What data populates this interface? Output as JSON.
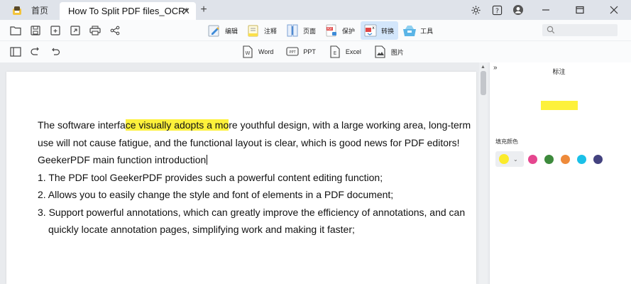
{
  "titlebar": {
    "home_tab": "首页",
    "doc_tab": "How To Split PDF files_OCR*",
    "close": "✕",
    "new_tab": "+"
  },
  "toolbar_modes": [
    {
      "label": "编辑",
      "icon": "edit-icon"
    },
    {
      "label": "注释",
      "icon": "annotate-icon"
    },
    {
      "label": "页面",
      "icon": "page-icon"
    },
    {
      "label": "保护",
      "icon": "protect-icon"
    },
    {
      "label": "转换",
      "icon": "convert-icon",
      "active": true
    },
    {
      "label": "工具",
      "icon": "tools-icon"
    }
  ],
  "convert_options": [
    {
      "label": "Word",
      "icon": "word-icon"
    },
    {
      "label": "PPT",
      "icon": "ppt-icon"
    },
    {
      "label": "Excel",
      "icon": "excel-icon"
    },
    {
      "label": "图片",
      "icon": "image-icon"
    }
  ],
  "document": {
    "line1_a": "The software interfa",
    "line1_hl": "ce visually adopts a mo",
    "line1_b": "re youthful design, with a large working area, long-term",
    "line2": "use will not cause fatigue, and the functional layout is clear, which is good news for PDF editors!",
    "line3": "GeekerPDF main function introduction",
    "line4": "1. The PDF tool GeekerPDF provides such a powerful content editing function;",
    "line5": "2. Allows you to easily change the style and font of elements in a PDF document;",
    "line6": "3. Support powerful annotations, which can greatly improve the efficiency of annotations, and can",
    "line7": "quickly locate annotation pages, simplifying work and making it faster;",
    "highlight_color": "#fdf13b"
  },
  "panel": {
    "collapse": "»",
    "title": "标注",
    "fill_label": "填充颜色",
    "selected_color": "#fbeb2b",
    "colors": [
      "#e5468f",
      "#3d8a3c",
      "#ee8a3a",
      "#1ac0e8",
      "#43427f"
    ]
  }
}
